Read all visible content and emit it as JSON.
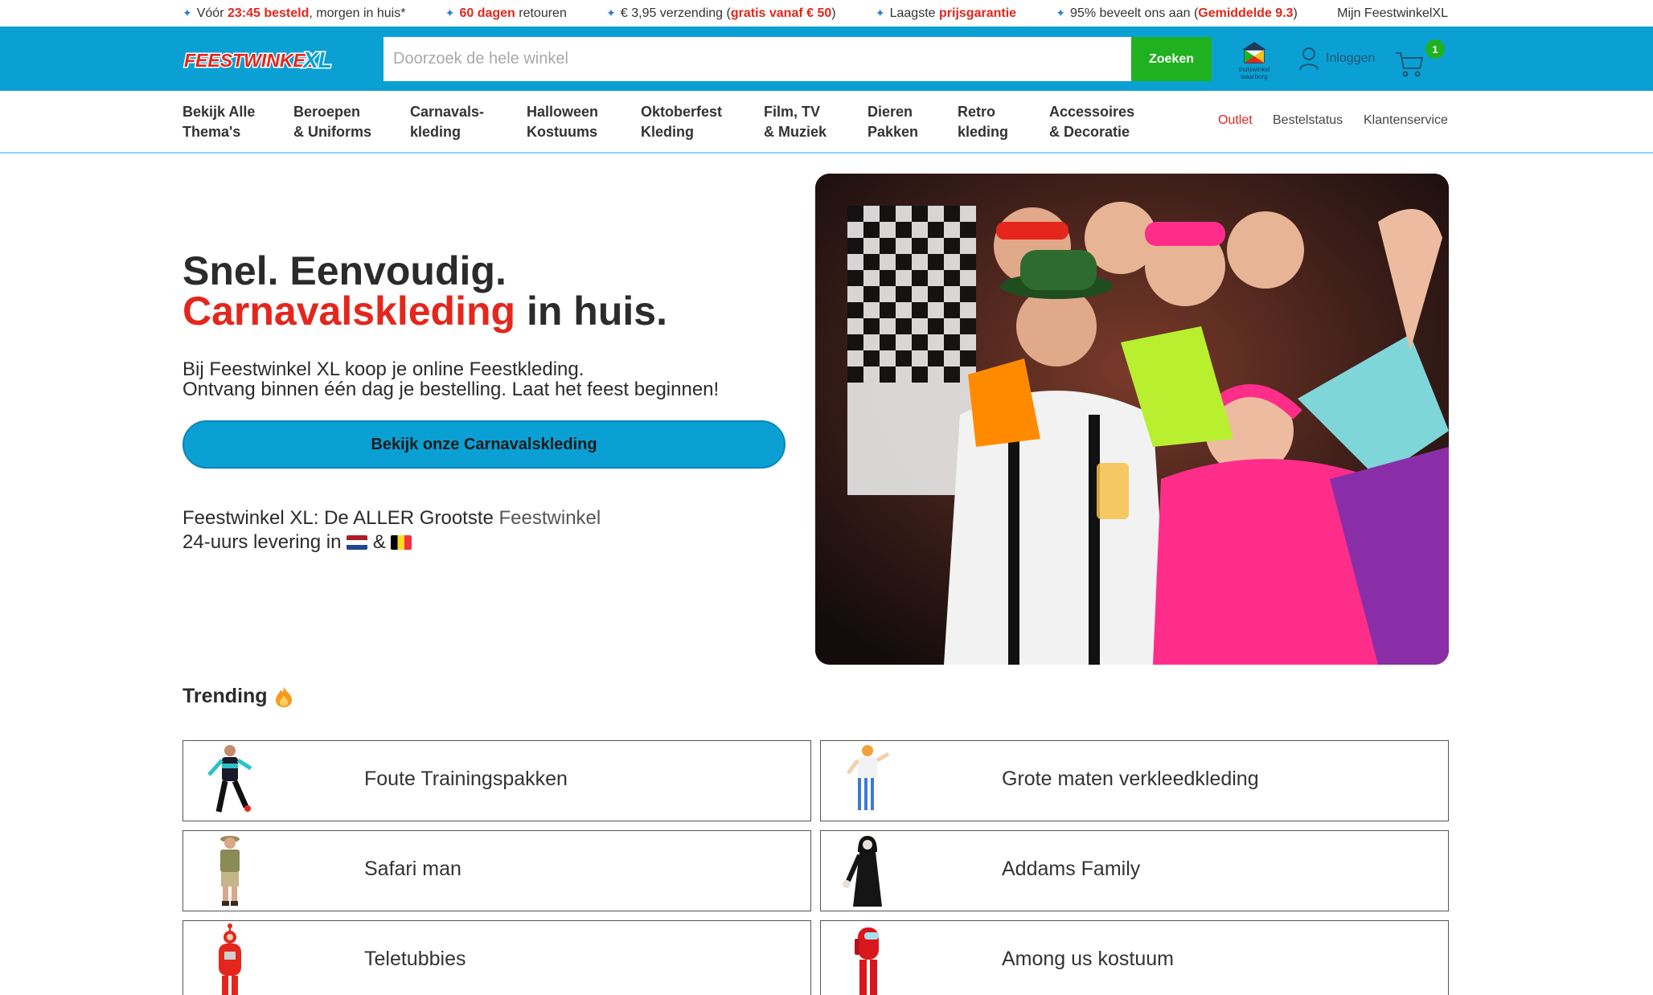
{
  "usp_bar": {
    "item1": {
      "pre": "Vóór ",
      "hl": "23:45 besteld",
      "post": ", morgen in huis*"
    },
    "item2": {
      "hl": "60 dagen",
      "post": " retouren"
    },
    "item3": {
      "pre": "€ 3,95 verzending (",
      "hl": "gratis vanaf € 50",
      "post": ")"
    },
    "item4": {
      "pre": "Laagste ",
      "hl": "prijsgarantie"
    },
    "item5": {
      "pre": "95% beveelt ons aan (",
      "hl": "Gemiddelde 9.3",
      "post": ")"
    },
    "account_link": "Mijn FeestwinkelXL"
  },
  "header": {
    "logo_text": "FEESTWINKEL",
    "logo_xl": "XL",
    "search_placeholder": "Doorzoek de hele winkel",
    "search_button": "Zoeken",
    "thuiswinkel_label": "thuiswinkel waarborg",
    "login_label": "Inloggen",
    "cart_count": "1"
  },
  "nav": {
    "items": [
      {
        "line1": "Bekijk Alle",
        "line2": "Thema's"
      },
      {
        "line1": "Beroepen",
        "line2": "& Uniforms"
      },
      {
        "line1": "Carnavals-",
        "line2": "kleding"
      },
      {
        "line1": "Halloween",
        "line2": "Kostuums"
      },
      {
        "line1": "Oktoberfest",
        "line2": "Kleding"
      },
      {
        "line1": "Film, TV",
        "line2": "& Muziek"
      },
      {
        "line1": "Dieren",
        "line2": "Pakken"
      },
      {
        "line1": "Retro",
        "line2": "kleding"
      },
      {
        "line1": "Accessoires",
        "line2": "& Decoratie"
      }
    ],
    "right": [
      "Outlet",
      "Bestelstatus",
      "Klantenservice"
    ]
  },
  "hero": {
    "title_line1": "Snel. Eenvoudig.",
    "title_red": "Carnavalskleding",
    "title_rest": " in huis.",
    "sub_line1": "Bij Feestwinkel XL koop je online Feestkleding.",
    "sub_line2": "Ontvang binnen één dag je bestelling. Laat het feest beginnen!",
    "cta": "Bekijk onze Carnavalskleding",
    "note_pre": "Feestwinkel XL: De ALLER Grootste ",
    "note_link": "Feestwinkel",
    "note_line2_pre": "24-uurs levering in ",
    "note_amp": " & "
  },
  "trending": {
    "title": "Trending",
    "items": [
      {
        "label": "Foute Trainingspakken"
      },
      {
        "label": "Grote maten verkleedkleding"
      },
      {
        "label": "Safari man"
      },
      {
        "label": "Addams Family"
      },
      {
        "label": "Teletubbies"
      },
      {
        "label": "Among us kostuum"
      }
    ]
  },
  "colors": {
    "brand_blue": "#0aa0d4",
    "accent_red": "#e4261c",
    "search_green": "#1fb11f"
  }
}
